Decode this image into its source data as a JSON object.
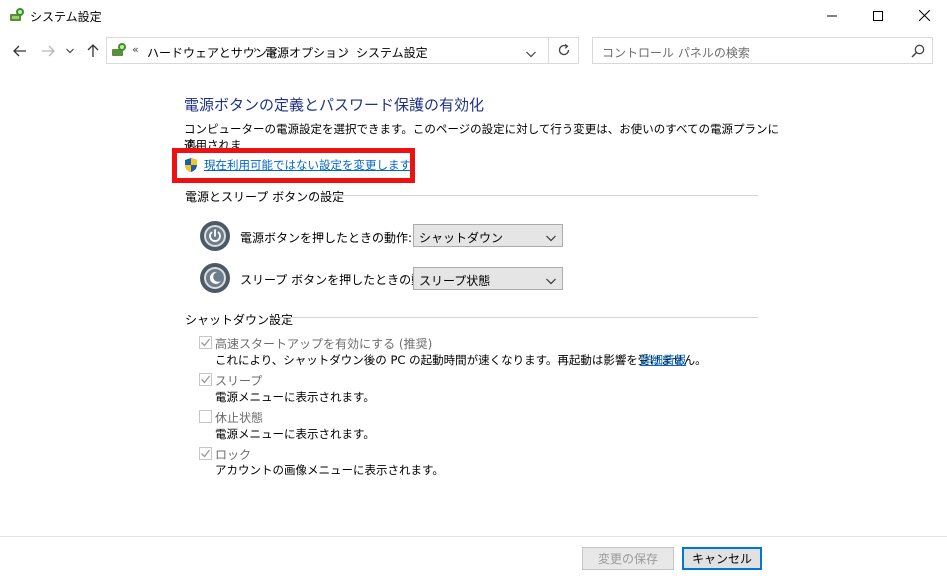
{
  "window": {
    "title": "システム設定",
    "controls": {
      "minimize": "minimize-icon",
      "maximize": "maximize-icon",
      "close": "close-icon"
    }
  },
  "nav": {
    "back": "back-arrow-icon",
    "forward": "forward-arrow-icon",
    "recent": "chevron-down-icon",
    "up": "up-arrow-icon"
  },
  "address": {
    "overflow": "«",
    "crumbs": [
      "ハードウェアとサウンド",
      "電源オプション",
      "システム設定"
    ],
    "separator": "›",
    "refresh": "refresh-icon"
  },
  "search": {
    "placeholder": "コントロール パネルの検索",
    "icon": "search-icon"
  },
  "main": {
    "heading": "電源ボタンの定義とパスワード保護の有効化",
    "description_line1": "コンピューターの電源設定を選択できます。このページの設定に対して行う変更は、お使いのすべての電源プランに適用されま",
    "description_line2": "す。",
    "change_link": "現在利用可能ではない設定を変更します",
    "highlight_color": "#ee1111",
    "power_section": {
      "title": "電源とスリープ ボタンの設定",
      "rows": [
        {
          "label": "電源ボタンを押したときの動作:",
          "value": "シャットダウン",
          "icon": "power-button-icon"
        },
        {
          "label": "スリープ ボタンを押したときの動作:",
          "value": "スリープ状態",
          "icon": "sleep-button-icon"
        }
      ]
    },
    "shutdown_section": {
      "title": "シャットダウン設定",
      "items": [
        {
          "label": "高速スタートアップを有効にする (推奨)",
          "checked": true,
          "desc": "これにより、シャットダウン後の PC の起動時間が速くなります。再起動は影響を受けません。",
          "link": "詳細情報"
        },
        {
          "label": "スリープ",
          "checked": true,
          "desc": "電源メニューに表示されます。"
        },
        {
          "label": "休止状態",
          "checked": false,
          "desc": "電源メニューに表示されます。"
        },
        {
          "label": "ロック",
          "checked": true,
          "desc": "アカウントの画像メニューに表示されます。"
        }
      ]
    }
  },
  "footer": {
    "save": "変更の保存",
    "cancel": "キャンセル"
  },
  "colors": {
    "heading": "#1e3287",
    "link": "#0066cc",
    "accent": "#0078d7"
  }
}
